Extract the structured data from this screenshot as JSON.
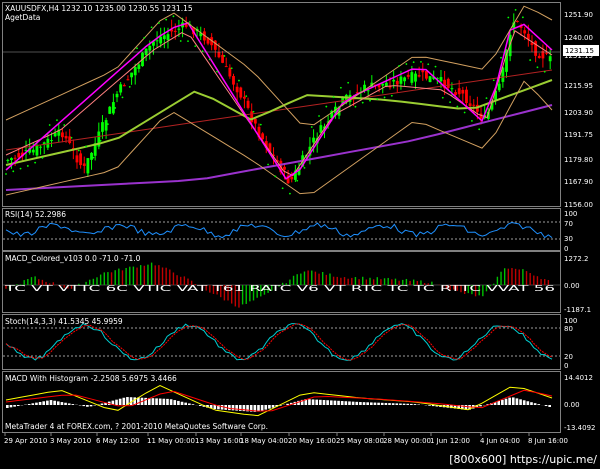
{
  "main": {
    "symbol_line": "XAUUSDFX,H4  1232.10 1235.00 1230.55 1231.15",
    "indicator_line": "AgetData",
    "price_labels": [
      "1251.90",
      "1240.00",
      "1231.15",
      "1215.95",
      "1203.90",
      "1191.75",
      "1179.80",
      "1167.90",
      "1156.00"
    ],
    "current_price": "1231.15"
  },
  "rsi": {
    "title": "RSI(14) 52.2986",
    "labels": [
      "100",
      "70",
      "30",
      "0"
    ]
  },
  "macd_colored": {
    "title": "MACD_Colored_v103 0.0 -71.0 -71.0",
    "labels": [
      "1272.2",
      "0.00",
      "-1187.1"
    ],
    "signal_text": "TC VT VTTC 6C VTIC VAT T61 RATC V6 VT RTC TC TC RTTC VVAT 56"
  },
  "stoch": {
    "title": "Stoch(14,3,3) 41.5345 45.9959",
    "labels": [
      "100",
      "80",
      "20",
      "0"
    ]
  },
  "macd_hist": {
    "title": "MACD With Histogram -2.2508 5.6975 3.4466",
    "labels": [
      "14.4012",
      "0.00",
      "-13.4092"
    ],
    "copyright": "MetaTrader 4 at FOREX.com, ? 2001-2010 MetaQuotes Software Corp."
  },
  "time_axis": [
    "29 Apr 2010",
    "3 May 2010",
    "6 May 12:00",
    "11 May 00:00",
    "13 May 16:00",
    "18 May 04:00",
    "20 May 16:00",
    "25 May 08:00",
    "28 May 00:00",
    "1 Jun 12:00",
    "4 Jun 04:00",
    "8 Jun 16:00"
  ],
  "watermark": "[800x600] https://upic.me/",
  "colors": {
    "background": "#000000",
    "bull_bar": "#00ff00",
    "bear_bar": "#ff0000",
    "ma_fast": "#ff00ff",
    "ma_slow": "#9a32cd",
    "ma_yellowgreen": "#9acd32",
    "trend_line": "#b22222",
    "bands": "#d2a060",
    "psar": "#00ff00",
    "rsi_line": "#1e90ff",
    "stoch_main": "#00ced1",
    "stoch_signal": "#ff0000",
    "macd_line": "#ffff00",
    "macd_signal": "#ff0000",
    "hist": "#ffffff"
  }
}
